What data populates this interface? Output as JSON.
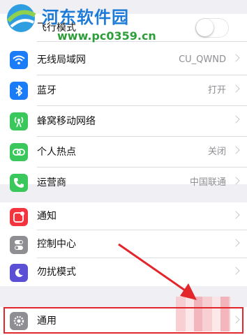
{
  "watermark": {
    "title": "河东软件园",
    "url": "www.pc0359.cn"
  },
  "colors": {
    "wifi": "#1a7df7",
    "bluetooth": "#1a7df7",
    "cellular": "#3ac85c",
    "hotspot": "#3ac85c",
    "carrier": "#3ac85c",
    "notifications": "#f5333f",
    "control_center": "#8e8e93",
    "dnd": "#5b4fd6",
    "general": "#8e8e93",
    "arrow": "#e2262c"
  },
  "group1": [
    {
      "label": "飞行模式",
      "icon": "airplane-icon",
      "detail": "",
      "toggle": false
    },
    {
      "label": "无线局域网",
      "icon": "wifi-icon",
      "detail": "CU_QWND"
    },
    {
      "label": "蓝牙",
      "icon": "bluetooth-icon",
      "detail": "打开"
    },
    {
      "label": "蜂窝移动网络",
      "icon": "cellular-icon",
      "detail": ""
    },
    {
      "label": "个人热点",
      "icon": "hotspot-icon",
      "detail": "关闭"
    },
    {
      "label": "运营商",
      "icon": "phone-icon",
      "detail": "中国联通"
    }
  ],
  "group2": [
    {
      "label": "通知",
      "icon": "notifications-icon"
    },
    {
      "label": "控制中心",
      "icon": "control-center-icon"
    },
    {
      "label": "勿扰模式",
      "icon": "moon-icon"
    }
  ],
  "group3": [
    {
      "label": "通用",
      "icon": "gear-icon"
    }
  ]
}
